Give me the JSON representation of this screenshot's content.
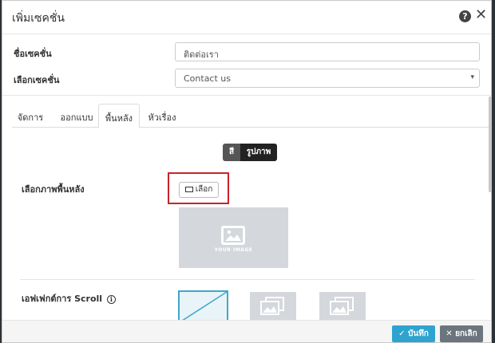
{
  "dialog": {
    "title": "เพิ่มเซคชั่น",
    "help_icon": "help-circle-icon",
    "close_icon": "close-icon"
  },
  "form": {
    "section_name_label": "ชื่อเซคชั่น",
    "section_name_value": "ติดต่อเรา",
    "select_section_label": "เลือกเซคชั่น",
    "select_section_value": "Contact us"
  },
  "tabs": [
    {
      "label": "จัดการ",
      "active": false
    },
    {
      "label": "ออกแบบ",
      "active": false
    },
    {
      "label": "พื้นหลัง",
      "active": true
    },
    {
      "label": "หัวเรื่อง",
      "active": false
    }
  ],
  "background": {
    "toggle": {
      "color_label": "สี",
      "image_label": "รูปภาพ",
      "selected": "รูปภาพ"
    },
    "choose_label": "เลือกภาพพื้นหลัง",
    "choose_button": "เลือก",
    "placeholder_text": "YOUR IMAGE"
  },
  "scroll_effect": {
    "label": "เอฟเฟกต์การ Scroll",
    "info_icon": "info-icon",
    "options": [
      {
        "name": "none",
        "selected": true
      },
      {
        "name": "parallax",
        "selected": false
      },
      {
        "name": "fixed",
        "selected": false
      }
    ]
  },
  "footer": {
    "save_label": "บันทึก",
    "cancel_label": "ยกเลิก"
  },
  "colors": {
    "accent": "#2ea3cf",
    "highlight": "#c9242b",
    "cancel": "#6c757d"
  }
}
